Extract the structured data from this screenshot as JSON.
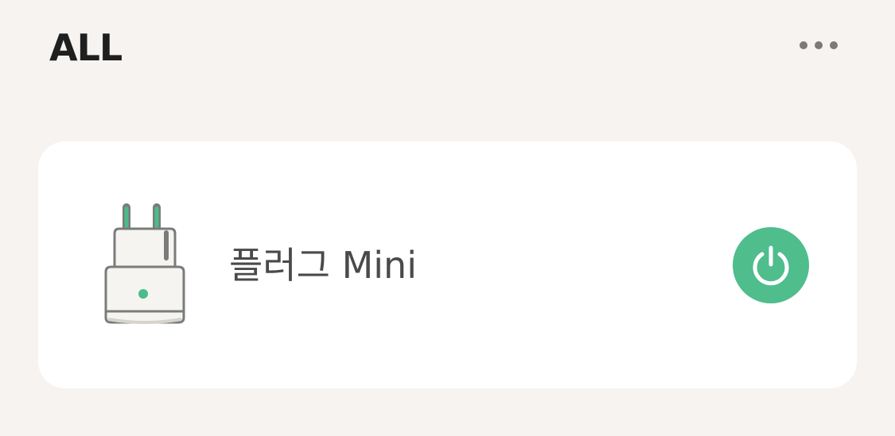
{
  "header": {
    "title": "ALL",
    "more_icon": "more-horizontal-icon"
  },
  "device": {
    "name": "플러그 Mini",
    "icon": "smart-plug-icon",
    "power_icon": "power-icon",
    "power_state": "on",
    "accent_color": "#4fbd8c"
  },
  "colors": {
    "background": "#f6f3f0",
    "card": "#ffffff",
    "title": "#1f1f1f",
    "device_name": "#4a4a4a",
    "more_dots": "#7a7a7a"
  }
}
